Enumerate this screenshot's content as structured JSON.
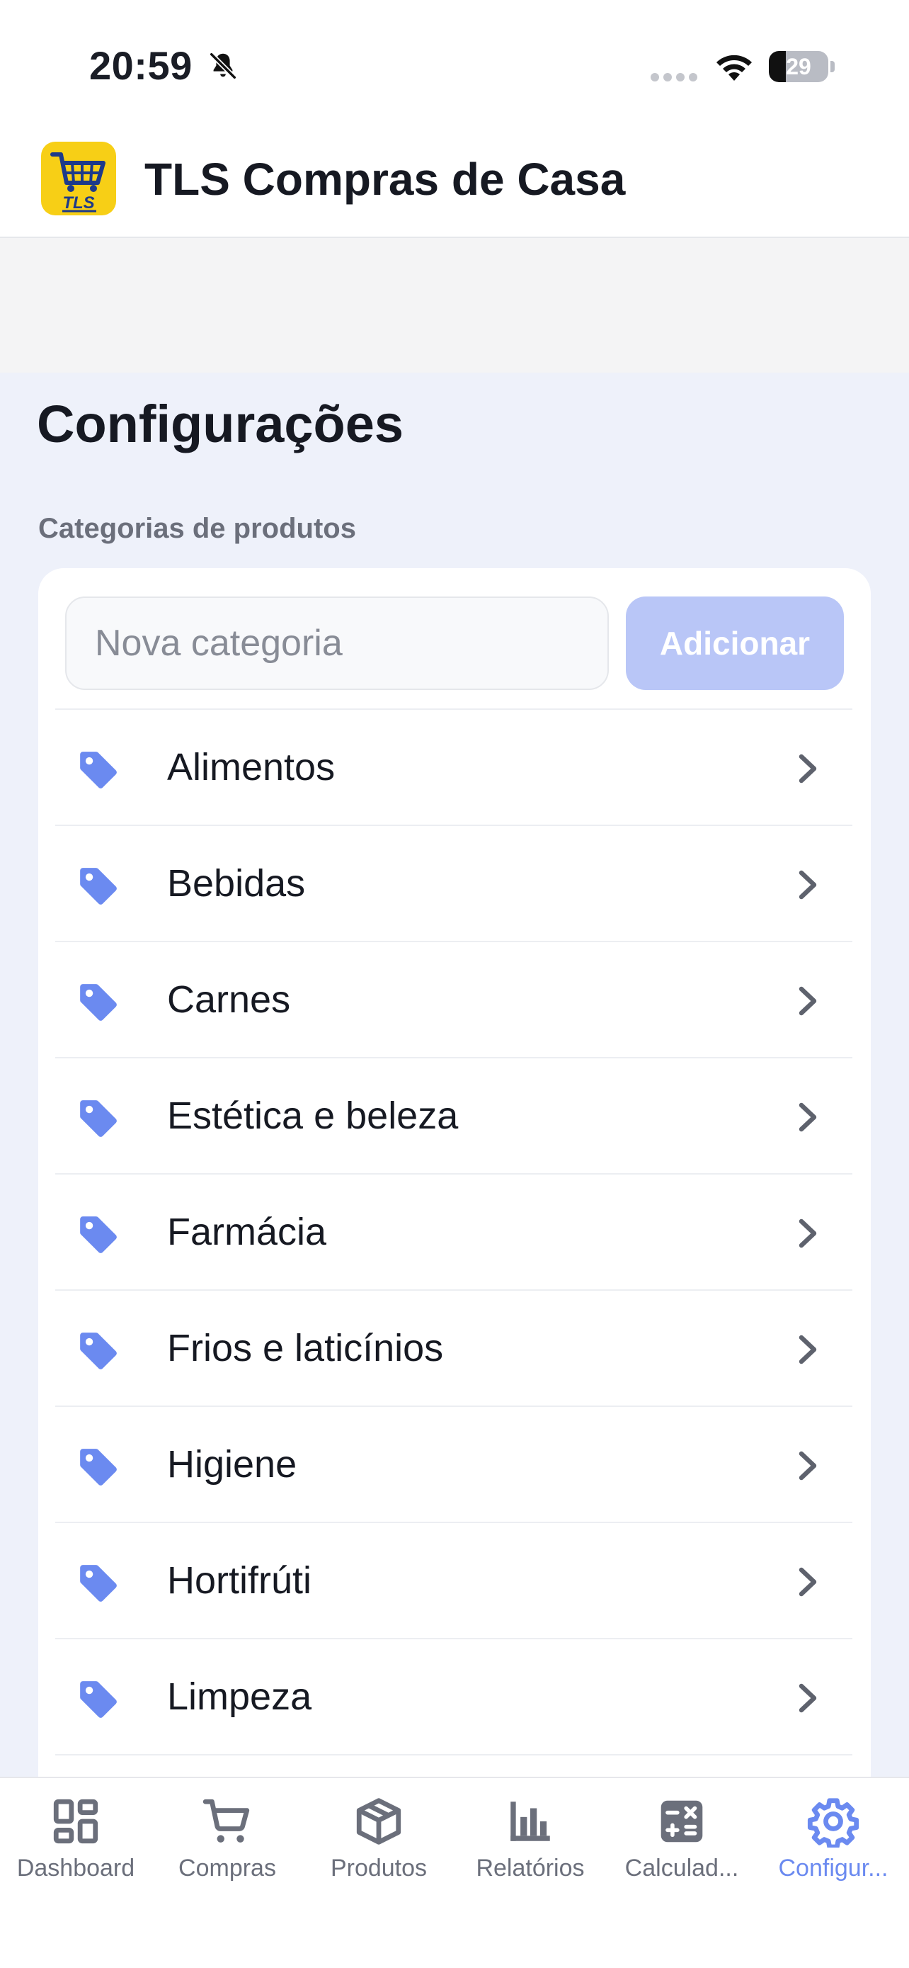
{
  "status_bar": {
    "time": "20:59",
    "battery_level": "29",
    "icons": [
      "bell-slash-icon",
      "signal-dots-icon",
      "wifi-icon",
      "battery-icon"
    ]
  },
  "app": {
    "title": "TLS Compras de Casa",
    "logo_text": "TLS",
    "logo_color": "#f7cf16"
  },
  "page": {
    "title": "Configurações",
    "section_label": "Categorias de produtos"
  },
  "new_category": {
    "value": "",
    "placeholder": "Nova categoria",
    "add_label": "Adicionar"
  },
  "categories": [
    {
      "label": "Alimentos",
      "icon": "tag-icon"
    },
    {
      "label": "Bebidas",
      "icon": "tag-icon"
    },
    {
      "label": "Carnes",
      "icon": "tag-icon"
    },
    {
      "label": "Estética e beleza",
      "icon": "tag-icon"
    },
    {
      "label": "Farmácia",
      "icon": "tag-icon"
    },
    {
      "label": "Frios e laticínios",
      "icon": "tag-icon"
    },
    {
      "label": "Higiene",
      "icon": "tag-icon"
    },
    {
      "label": "Hortifrúti",
      "icon": "tag-icon"
    },
    {
      "label": "Limpeza",
      "icon": "tag-icon"
    }
  ],
  "tabs": [
    {
      "label": "Dashboard",
      "icon": "dashboard-icon",
      "active": false
    },
    {
      "label": "Compras",
      "icon": "cart-icon",
      "active": false
    },
    {
      "label": "Produtos",
      "icon": "box-icon",
      "active": false
    },
    {
      "label": "Relatórios",
      "icon": "bar-chart-icon",
      "active": false
    },
    {
      "label": "Calculad...",
      "icon": "calculator-icon",
      "active": false
    },
    {
      "label": "Configur...",
      "icon": "gear-icon",
      "active": true
    }
  ],
  "colors": {
    "accent": "#6b8af0",
    "accent_light": "#b9c6f7",
    "background": "#eef1fa",
    "inactive_tab": "#6b6f7b"
  }
}
